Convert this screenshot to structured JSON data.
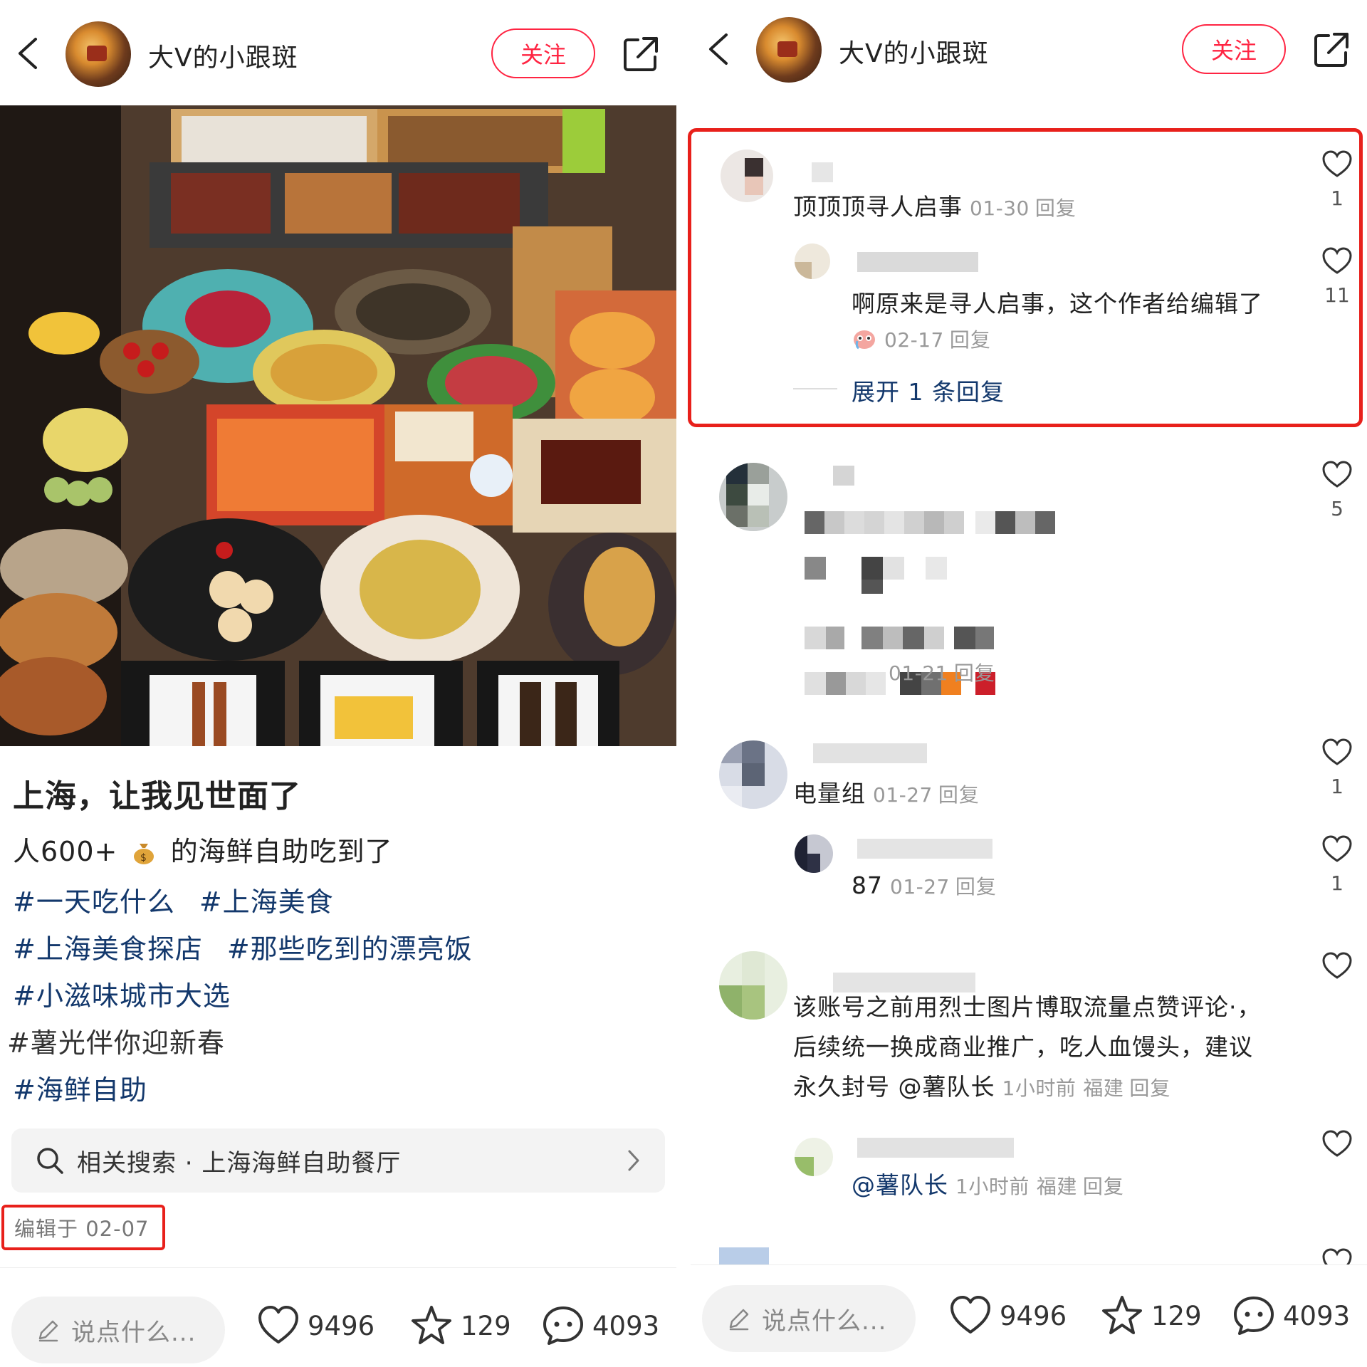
{
  "left": {
    "header": {
      "username": "大V的小跟斑",
      "follow": "关注"
    },
    "post": {
      "title": "上海，让我见世面了",
      "desc_prefix": "人600+",
      "desc_suffix": "的海鲜自助吃到了",
      "tag_lines": [
        [
          "#一天吃什么",
          "#上海美食"
        ],
        [
          "#上海美食探店",
          "#那些吃到的漂亮饭"
        ],
        [
          "#小滋味城市大选"
        ],
        [
          "#薯光伴你迎新春"
        ],
        [
          "#海鲜自助"
        ]
      ],
      "related_search": "相关搜索 · 上海海鲜自助餐厅",
      "edit_date": "编辑于 02-07"
    },
    "bottom": {
      "placeholder": "说点什么...",
      "likes": "9496",
      "stars": "129",
      "comments": "4093"
    }
  },
  "right": {
    "header": {
      "username": "大V的小跟斑",
      "follow": "关注"
    },
    "comments": [
      {
        "text": "顶顶顶寻人启事",
        "date": "01-30",
        "reply": "回复",
        "likes": "1"
      },
      {
        "text": "啊原来是寻人启事，这个作者给编辑了",
        "date": "02-17",
        "reply": "回复",
        "likes": "11"
      },
      {
        "expand": "展开 1 条回复"
      },
      {
        "date": "01-21",
        "reply": "回复",
        "likes": "5"
      },
      {
        "text": "电量组",
        "date": "01-27",
        "reply": "回复",
        "likes": "1"
      },
      {
        "text": "87",
        "date": "01-27",
        "reply": "回复",
        "likes": "1"
      },
      {
        "line1": "该账号之前用烈士图片博取流量点赞评论·，",
        "line2": "后续统一换成商业推广，吃人血馒头，建议",
        "line3_prefix": "永久封号",
        "line3_mention": "@薯队长",
        "time": "1小时前",
        "location": "福建",
        "reply": "回复"
      },
      {
        "mention": "@薯队长",
        "time": "1小时前",
        "location": "福建",
        "reply": "回复"
      }
    ],
    "bottom": {
      "placeholder": "说点什么...",
      "likes": "9496",
      "stars": "129",
      "comments": "4093"
    }
  },
  "colors": {
    "accent": "#ff2442",
    "tag": "#13386c",
    "highlight": "#e8201b"
  }
}
